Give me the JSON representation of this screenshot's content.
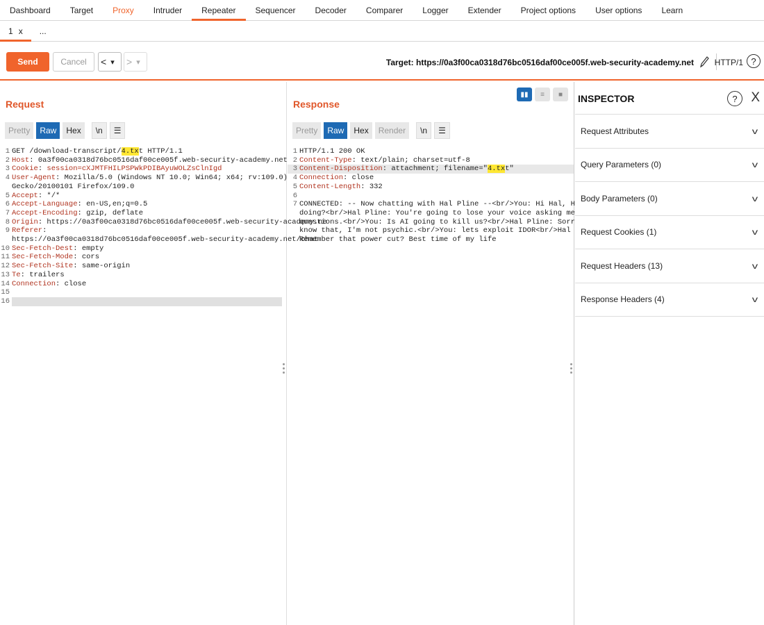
{
  "nav": {
    "tabs": [
      "Dashboard",
      "Target",
      "Proxy",
      "Intruder",
      "Repeater",
      "Sequencer",
      "Decoder",
      "Comparer",
      "Logger",
      "Extender",
      "Project options",
      "User options",
      "Learn"
    ],
    "active": "Repeater"
  },
  "subtabs": {
    "first_label": "1",
    "close_glyph": "x",
    "more_label": "..."
  },
  "toolbar": {
    "send_label": "Send",
    "cancel_label": "Cancel",
    "back_glyph": "<",
    "forward_glyph": ">",
    "dropdown_glyph": "▾",
    "target_text": "Target: https://0a3f00ca0318d76bc0516daf00ce005f.web-security-academy.net",
    "http_version": "HTTP/1",
    "help_glyph": "?"
  },
  "request": {
    "title": "Request",
    "view_tabs": [
      "Pretty",
      "Raw",
      "Hex"
    ],
    "active_view": "Raw",
    "newline_btn": "\\n",
    "menu_btn": "☰",
    "lines": [
      {
        "n": "1",
        "key": "",
        "val": "GET /download-transcript/",
        "hl": "4.tx",
        "after": "t HTTP/1.1"
      },
      {
        "n": "2",
        "key": "Host",
        "val": ": 0a3f00ca0318d76bc0516daf00ce005f.web-security-academy.net"
      },
      {
        "n": "3",
        "key": "Cookie",
        "val": ": ",
        "cookie_name": "session",
        "cookie_val": "=cXJMTFHILPSPWkPDIBAyuWOLZsClnIgd"
      },
      {
        "n": "4",
        "key": "User-Agent",
        "val": ": Mozilla/5.0 (Windows NT 10.0; Win64; x64; rv:109.0)"
      },
      {
        "n": "",
        "key": "",
        "val": "Gecko/20100101 Firefox/109.0"
      },
      {
        "n": "5",
        "key": "Accept",
        "val": ": */*"
      },
      {
        "n": "6",
        "key": "Accept-Language",
        "val": ": en-US,en;q=0.5"
      },
      {
        "n": "7",
        "key": "Accept-Encoding",
        "val": ": gzip, deflate"
      },
      {
        "n": "8",
        "key": "Origin",
        "val": ": https://0a3f00ca0318d76bc0516daf00ce005f.web-security-academy.ne"
      },
      {
        "n": "9",
        "key": "Referer",
        "val": ":"
      },
      {
        "n": "",
        "key": "",
        "val": "https://0a3f00ca0318d76bc0516daf00ce005f.web-security-academy.net/chat"
      },
      {
        "n": "10",
        "key": "Sec-Fetch-Dest",
        "val": ": empty"
      },
      {
        "n": "11",
        "key": "Sec-Fetch-Mode",
        "val": ": cors"
      },
      {
        "n": "12",
        "key": "Sec-Fetch-Site",
        "val": ": same-origin"
      },
      {
        "n": "13",
        "key": "Te",
        "val": ": trailers"
      },
      {
        "n": "14",
        "key": "Connection",
        "val": ": close"
      },
      {
        "n": "15",
        "key": "",
        "val": ""
      },
      {
        "n": "16",
        "key": "",
        "val": ""
      }
    ]
  },
  "response": {
    "title": "Response",
    "view_tabs": [
      "Pretty",
      "Raw",
      "Hex",
      "Render"
    ],
    "active_view": "Raw",
    "newline_btn": "\\n",
    "menu_btn": "☰",
    "lines": [
      {
        "n": "1",
        "key": "",
        "val": "HTTP/1.1 200 OK"
      },
      {
        "n": "2",
        "key": "Content-Type",
        "val": ": text/plain; charset=utf-8"
      },
      {
        "n": "3",
        "key": "Content-Disposition",
        "val": ": attachment; filename=\"",
        "hl": "4.tx",
        "after": "t\""
      },
      {
        "n": "4",
        "key": "Connection",
        "val": ": close"
      },
      {
        "n": "5",
        "key": "Content-Length",
        "val": ": 332"
      },
      {
        "n": "6",
        "key": "",
        "val": ""
      },
      {
        "n": "7",
        "key": "",
        "val": "CONNECTED: -- Now chatting with Hal Pline --<br/>You: Hi Hal, How are you"
      },
      {
        "n": "",
        "key": "",
        "val": "doing?<br/>Hal Pline: You're going to lose your voice asking me silly"
      },
      {
        "n": "",
        "key": "",
        "val": "questions.<br/>You: Is AI going to kill us?<br/>Hal Pline: Sorry I don't"
      },
      {
        "n": "",
        "key": "",
        "val": "know that, I'm not psychic.<br/>You: lets exploit IDOR<br/>Hal Pline:"
      },
      {
        "n": "",
        "key": "",
        "val": "Remember that power cut? Best time of my life"
      }
    ]
  },
  "inspector": {
    "title": "INSPECTOR",
    "help_glyph": "?",
    "close_glyph": "X",
    "sections": [
      "Request Attributes",
      "Query Parameters (0)",
      "Body Parameters (0)",
      "Request Cookies (1)",
      "Request Headers (13)",
      "Response Headers (4)"
    ],
    "chevron": "v"
  },
  "colors": {
    "accent": "#f0642c",
    "active_tab": "#1e6ab4",
    "header_key": "#b0321e",
    "highlight": "#ffe733"
  }
}
